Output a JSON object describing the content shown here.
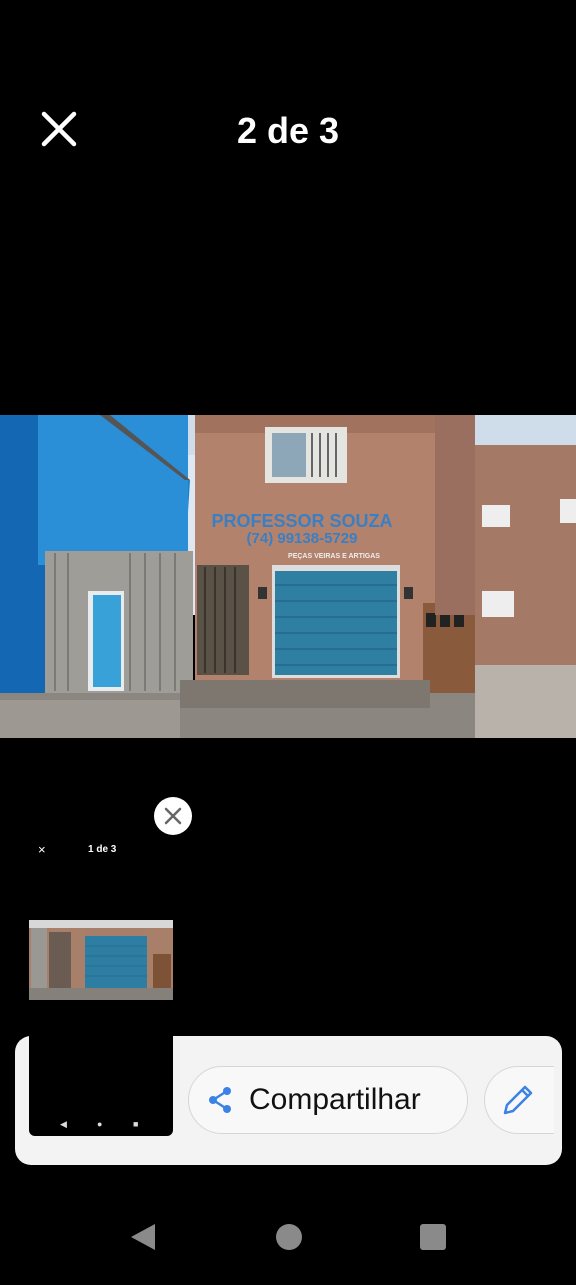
{
  "header": {
    "close_icon": "close-icon",
    "counter": "2 de 3"
  },
  "photo": {
    "sign_name": "PROFESSOR SOUZA",
    "sign_phone": "(74) 99138-5729",
    "sign_sub": "PEÇAS VEIRAS E ARTIGAS"
  },
  "thumbnail": {
    "dismiss_icon": "close-icon",
    "mini_close": "×",
    "mini_counter": "1 de 3"
  },
  "share_sheet": {
    "share_label": "Compartilhar",
    "share_icon": "share-icon",
    "edit_icon": "pencil-icon",
    "accent_color": "#3b82e6"
  },
  "nav": {
    "back_icon": "back-triangle-icon",
    "home_icon": "home-circle-icon",
    "recents_icon": "recents-square-icon"
  }
}
